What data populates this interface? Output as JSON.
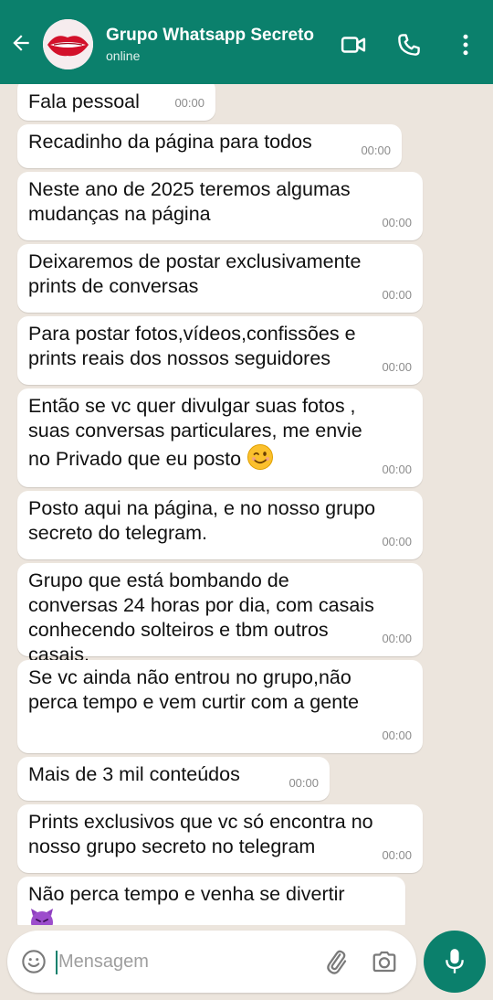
{
  "header": {
    "title": "Grupo Whatsapp Secreto",
    "status": "online",
    "colors": {
      "bar": "#0b806c",
      "text": "#ffffff"
    },
    "icons": [
      "back-arrow-icon",
      "video-call-icon",
      "phone-call-icon",
      "more-options-icon"
    ]
  },
  "messages": [
    {
      "text": "Fala pessoal",
      "time": "00:00"
    },
    {
      "text": "Recadinho da página para todos",
      "time": "00:00"
    },
    {
      "text": "Neste ano de 2025 teremos algumas mudanças na página",
      "time": "00:00"
    },
    {
      "text": "Deixaremos de postar exclusivamente prints de conversas",
      "time": "00:00"
    },
    {
      "text": "Para postar fotos,vídeos,confissões e prints reais dos nossos seguidores",
      "time": "00:00"
    },
    {
      "text": "Então se vc quer divulgar suas fotos , suas conversas particulares, me envie no Privado que eu posto",
      "emoji": "winking-face",
      "time": "00:00"
    },
    {
      "text": "Posto aqui na página, e no nosso grupo secreto do telegram.",
      "time": "00:00"
    },
    {
      "text": "Grupo que está bombando de conversas 24 horas por dia, com casais conhecendo solteiros e tbm outros casais.",
      "time": "00:00"
    },
    {
      "text": "Se vc ainda não entrou no grupo,não perca tempo e vem curtir com a gente",
      "time": "00:00"
    },
    {
      "text": "Mais de 3 mil conteúdos",
      "time": "00:00"
    },
    {
      "text": "Prints exclusivos que vc só encontra no nosso grupo secreto no telegram",
      "time": "00:00"
    },
    {
      "text": "Não perca tempo e venha se divertir",
      "emoji": "smiling-devil",
      "time": ""
    }
  ],
  "composer": {
    "placeholder": "Mensagem",
    "icons": [
      "emoji-icon",
      "attach-icon",
      "camera-icon",
      "mic-icon"
    ]
  }
}
